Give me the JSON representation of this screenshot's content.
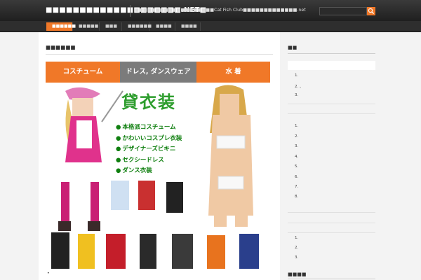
{
  "header": {
    "site_title": "■■■■■■■■■■■■■■■■■■■■.NET■",
    "tagline": "■■■■■■■■■■■■■■■■■■■Cat Fish Club■■■■■■■■■■■■■.net",
    "search_placeholder": "",
    "search_icon": "magnifier-icon"
  },
  "nav": {
    "items": [
      {
        "label": "■■■■■■",
        "active": true
      },
      {
        "label": "■■■■■"
      },
      {
        "label": "■■■"
      },
      {
        "label": "■■■■■■"
      },
      {
        "label": "■■■■"
      },
      {
        "label": "■■■■"
      }
    ]
  },
  "post": {
    "title": "■■■■■■",
    "categories": [
      {
        "label": "コスチューム",
        "color": "#f07828"
      },
      {
        "label": "ドレス, ダンスウェア",
        "color": "#7b7b7b"
      },
      {
        "label": "水 着",
        "color": "#f07828"
      }
    ],
    "banner_heading": "貸衣装",
    "banner_items": [
      "本格派コスチューム",
      "かわいいコスプレ衣装",
      "デザイナーズビキニ",
      "セクシードレス",
      "ダンス衣装"
    ],
    "page_marker": "•"
  },
  "sidebar": {
    "widget1_title": "■■",
    "list1": [
      "1.",
      "2. 、",
      "3."
    ],
    "list2": [
      "1.",
      "2.",
      "3.",
      "4.",
      "5.",
      "6.",
      "7.",
      "8."
    ],
    "list3": [
      "1.",
      "2.",
      "3."
    ],
    "widget2_title": "■■■■"
  },
  "colors": {
    "accent": "#f07828",
    "header": "#262626",
    "green_text": "#0f7f0f"
  }
}
